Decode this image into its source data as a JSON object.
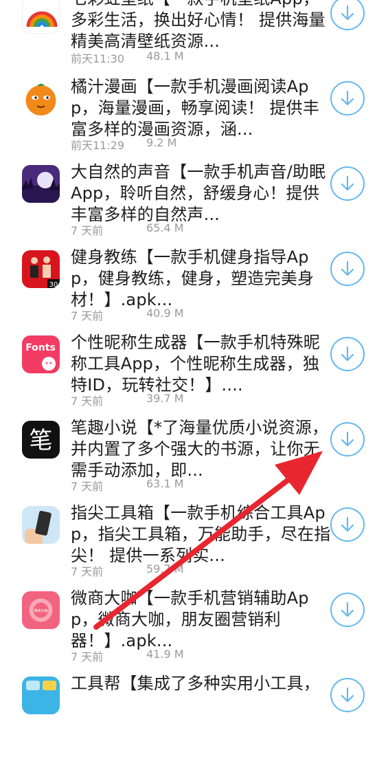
{
  "items": [
    {
      "title": "七彩虹壁纸【一款手机壁纸App，多彩生活，换出好心情！ 提供海量精美高清壁纸资源...",
      "time": "前天11:30",
      "size": "48.1 M",
      "icon": "rainbow-icon"
    },
    {
      "title": "橘汁漫画【一款手机漫画阅读App，海量漫画，畅享阅读！ 提供丰富多样的漫画资源，涵...",
      "time": "前天11:29",
      "size": "9.2 M",
      "icon": "orange-face-icon"
    },
    {
      "title": "大自然的声音【一款手机声音/助眠App，聆听自然，舒缓身心！提供丰富多样的自然声...",
      "time": "7 天前",
      "size": "65.4 M",
      "icon": "moon-lake-icon"
    },
    {
      "title": "健身教练【一款手机健身指导App，健身教练，健身，塑造完美身材！】.apk...",
      "time": "7 天前",
      "size": "40.9 M",
      "icon": "fitness-icon"
    },
    {
      "title": "个性昵称生成器【一款手机特殊昵称工具App，个性昵称生成器，独特ID，玩转社交！】....",
      "time": "7 天前",
      "size": "39.7 M",
      "icon": "fonts-icon"
    },
    {
      "title": "笔趣小说【*了海量优质小说资源，并内置了多个强大的书源，让你无需手动添加，即...",
      "time": "7 天前",
      "size": "63.1 M",
      "icon": "bi-character-icon"
    },
    {
      "title": "指尖工具箱【一款手机综合工具App，指尖工具箱，万能助手，尽在指尖！ 提供一系列实...",
      "time": "7 天前",
      "size": "59.7 M",
      "icon": "phone-hand-icon"
    },
    {
      "title": "微商大咖【一款手机营销辅助App，微商大咖，朋友圈营销利器！】.apk...",
      "time": "7 天前",
      "size": "41.9 M",
      "icon": "pink-circle-icon"
    },
    {
      "title": "工具帮【集成了多种实用小工具，",
      "time": "",
      "size": "",
      "icon": "toolbox-icon"
    }
  ],
  "icon_text": {
    "fonts": "Fonts",
    "bi": "笔",
    "weishang": "微商大咖",
    "fitness_num": "30"
  },
  "colors": {
    "accent": "#63b8ee",
    "arrow": "#e8262f",
    "meta": "#9a9a9a"
  }
}
